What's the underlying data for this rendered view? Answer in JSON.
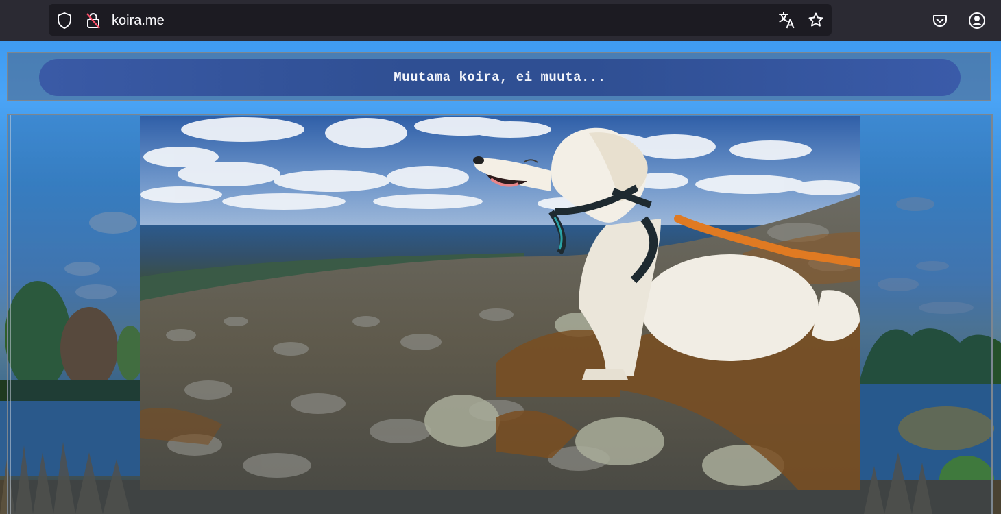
{
  "browser": {
    "url": "koira.me",
    "icons": {
      "shield": "tracking-protection-shield-icon",
      "connection": "insecure-connection-icon",
      "translate": "translate-icon",
      "bookmark": "bookmark-star-icon",
      "pocket": "pocket-icon",
      "account": "account-icon"
    }
  },
  "page": {
    "title": "Muutama koira, ei muuta...",
    "photo": {
      "subject": "dog-photo",
      "alt": ""
    }
  },
  "colors": {
    "chrome_bg": "#2b2a33",
    "urlbar_bg": "#1c1b22",
    "page_sky": "#3f9bf1",
    "header_pill": "#2f4f93",
    "frame_border": "#7c8690"
  }
}
